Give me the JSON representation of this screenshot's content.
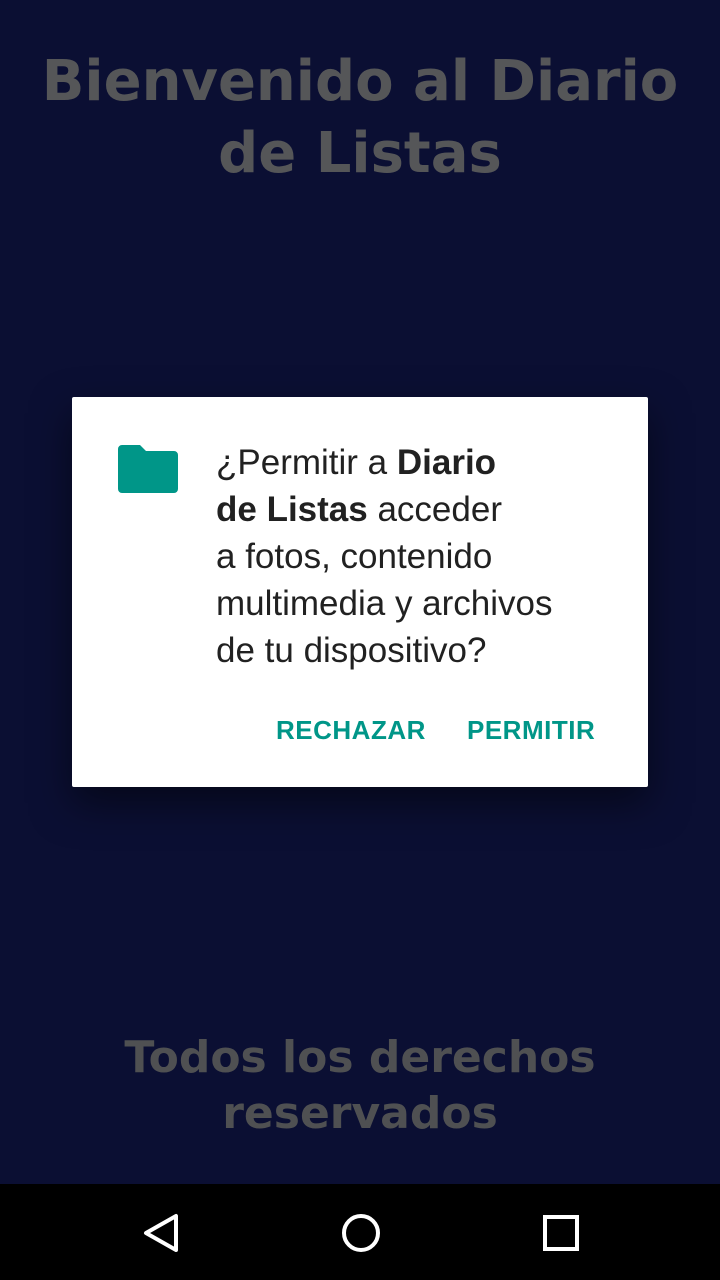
{
  "background": {
    "title_line1": "Bienvenido al Diario",
    "title_line2": "de Listas",
    "footer_line1": "Todos los derechos",
    "footer_line2": "reservados"
  },
  "dialog": {
    "icon": "folder-icon",
    "message_prefix": "¿Permitir a ",
    "app_name_line1": "Diario",
    "app_name_line2": "de Listas",
    "message_mid": " acceder",
    "message_line3": "a fotos, contenido",
    "message_line4": "multimedia y archivos",
    "message_line5": "de tu dispositivo?",
    "deny_label": "RECHAZAR",
    "allow_label": "PERMITIR",
    "accent_color": "#009688"
  },
  "navbar": {
    "back_icon": "back-triangle-icon",
    "home_icon": "home-circle-icon",
    "recents_icon": "recents-square-icon"
  }
}
